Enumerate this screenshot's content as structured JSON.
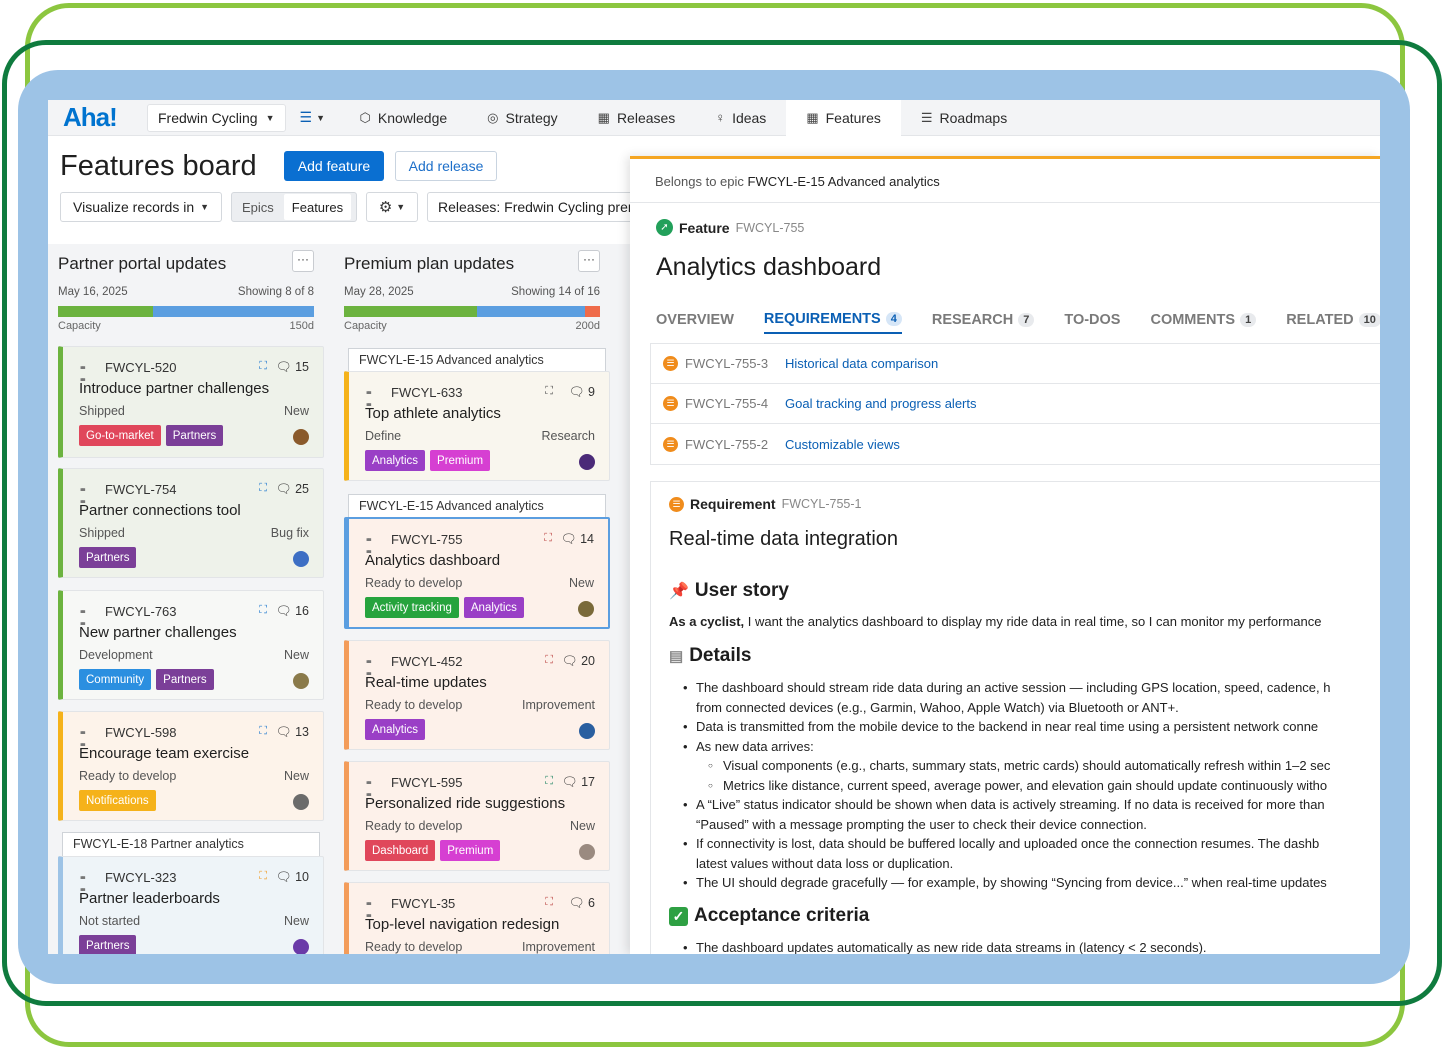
{
  "app": {
    "logo": "Aha!",
    "workspace": "Fredwin Cycling"
  },
  "nav": [
    {
      "label": "Knowledge",
      "icon": "knowledge-icon",
      "glyph": "⬡"
    },
    {
      "label": "Strategy",
      "icon": "strategy-icon",
      "glyph": "◎"
    },
    {
      "label": "Releases",
      "icon": "releases-icon",
      "glyph": "▦"
    },
    {
      "label": "Ideas",
      "icon": "ideas-icon",
      "glyph": "♀"
    },
    {
      "label": "Features",
      "icon": "features-icon",
      "glyph": "▦"
    },
    {
      "label": "Roadmaps",
      "icon": "roadmaps-icon",
      "glyph": "☰"
    }
  ],
  "board": {
    "title": "Features board",
    "add_feature": "Add feature",
    "add_release": "Add release",
    "visualize": "Visualize records in",
    "seg_epics": "Epics",
    "seg_features": "Features",
    "releases_filter": "Releases: Fredwin Cycling premium"
  },
  "columns": [
    {
      "title": "Partner portal updates",
      "more": "···",
      "date": "May 16, 2025",
      "showing": "Showing 8 of 8",
      "capacity_label": "Capacity",
      "capacity_value": "150d",
      "cards": [
        {
          "id": "FWCYL-520",
          "comments": "15",
          "name": "Introduce partner challenges",
          "status": "Shipped",
          "type": "New",
          "tags": [
            {
              "label": "Go-to-market",
              "color": "#e0475b"
            },
            {
              "label": "Partners",
              "color": "#7b3f98"
            }
          ]
        },
        {
          "id": "FWCYL-754",
          "comments": "25",
          "name": "Partner connections tool",
          "status": "Shipped",
          "type": "Bug fix",
          "tags": [
            {
              "label": "Partners",
              "color": "#7b3f98"
            }
          ]
        },
        {
          "id": "FWCYL-763",
          "comments": "16",
          "name": "New partner challenges",
          "status": "Development",
          "type": "New",
          "tags": [
            {
              "label": "Community",
              "color": "#2b8fe0"
            },
            {
              "label": "Partners",
              "color": "#7b3f98"
            }
          ]
        },
        {
          "id": "FWCYL-598",
          "comments": "13",
          "name": "Encourage team exercise",
          "status": "Ready to develop",
          "type": "New",
          "tags": [
            {
              "label": "Notifications",
              "color": "#f5b21a"
            }
          ]
        },
        {
          "id": "FWCYL-323",
          "comments": "10",
          "name": "Partner leaderboards",
          "status": "Not started",
          "type": "New",
          "tags": [
            {
              "label": "Partners",
              "color": "#7b3f98"
            }
          ]
        }
      ],
      "epic_header": "FWCYL-E-18 Partner analytics"
    },
    {
      "title": "Premium plan updates",
      "more": "···",
      "date": "May 28, 2025",
      "showing": "Showing 14 of 16",
      "capacity_label": "Capacity",
      "capacity_value": "200d",
      "epic_header_1": "FWCYL-E-15 Advanced analytics",
      "epic_header_2": "FWCYL-E-15 Advanced analytics",
      "cards": [
        {
          "id": "FWCYL-633",
          "comments": "9",
          "name": "Top athlete analytics",
          "status": "Define",
          "type": "Research",
          "tags": [
            {
              "label": "Analytics",
              "color": "#9a3fc6"
            },
            {
              "label": "Premium",
              "color": "#d63fd2"
            }
          ]
        },
        {
          "id": "FWCYL-755",
          "comments": "14",
          "name": "Analytics dashboard",
          "status": "Ready to develop",
          "type": "New",
          "tags": [
            {
              "label": "Activity tracking",
              "color": "#26a33d"
            },
            {
              "label": "Analytics",
              "color": "#9a3fc6"
            }
          ]
        },
        {
          "id": "FWCYL-452",
          "comments": "20",
          "name": "Real-time updates",
          "status": "Ready to develop",
          "type": "Improvement",
          "tags": [
            {
              "label": "Analytics",
              "color": "#9a3fc6"
            }
          ]
        },
        {
          "id": "FWCYL-595",
          "comments": "17",
          "name": "Personalized ride suggestions",
          "status": "Ready to develop",
          "type": "New",
          "tags": [
            {
              "label": "Dashboard",
              "color": "#e0475b"
            },
            {
              "label": "Premium",
              "color": "#d63fd2"
            }
          ]
        },
        {
          "id": "FWCYL-35",
          "comments": "6",
          "name": "Top-level navigation redesign",
          "status": "Ready to develop",
          "type": "Improvement",
          "tags": []
        }
      ]
    }
  ],
  "panel": {
    "belongs_prefix": "Belongs to epic",
    "belongs_epic": "FWCYL-E-15 Advanced analytics",
    "type_label": "Feature",
    "feature_id": "FWCYL-755",
    "feature_name": "Analytics dashboard",
    "tabs": [
      {
        "label": "OVERVIEW",
        "count": ""
      },
      {
        "label": "REQUIREMENTS",
        "count": "4"
      },
      {
        "label": "RESEARCH",
        "count": "7"
      },
      {
        "label": "TO-DOS",
        "count": ""
      },
      {
        "label": "COMMENTS",
        "count": "1"
      },
      {
        "label": "RELATED",
        "count": "10"
      }
    ],
    "requirements": [
      {
        "id": "FWCYL-755-3",
        "title": "Historical data comparison"
      },
      {
        "id": "FWCYL-755-4",
        "title": "Goal tracking and progress alerts"
      },
      {
        "id": "FWCYL-755-2",
        "title": "Customizable views"
      }
    ],
    "req_detail": {
      "type_label": "Requirement",
      "id": "FWCYL-755-1",
      "name": "Real-time data integration",
      "user_story_heading": "User story",
      "user_story_bold": "As a cyclist,",
      "user_story_text": " I want the analytics dashboard to display my ride data in real time, so I can monitor my performance",
      "details_heading": "Details",
      "details": [
        "The dashboard should stream ride data during an active session — including GPS location, speed, cadence, h",
        "from connected devices (e.g., Garmin, Wahoo, Apple Watch) via Bluetooth or ANT+.",
        "Data is transmitted from the mobile device to the backend in near real time using a persistent network conne",
        "As new data arrives:",
        "Visual components (e.g., charts, summary stats, metric cards) should automatically refresh within 1–2 sec",
        "Metrics like distance, current speed, average power, and elevation gain should update continuously witho",
        "A “Live” status indicator should be shown when data is actively streaming. If no data is received for more than",
        "“Paused” with a message prompting the user to check their device connection.",
        "If connectivity is lost, data should be buffered locally and uploaded once the connection resumes. The dashb",
        "latest values without data loss or duplication.",
        "The UI should degrade gracefully — for example, by showing “Syncing from device...” when real-time updates"
      ],
      "acceptance_heading": "Acceptance criteria",
      "acceptance": [
        "The dashboard updates automatically as new ride data streams in (latency < 2 seconds)."
      ]
    }
  }
}
